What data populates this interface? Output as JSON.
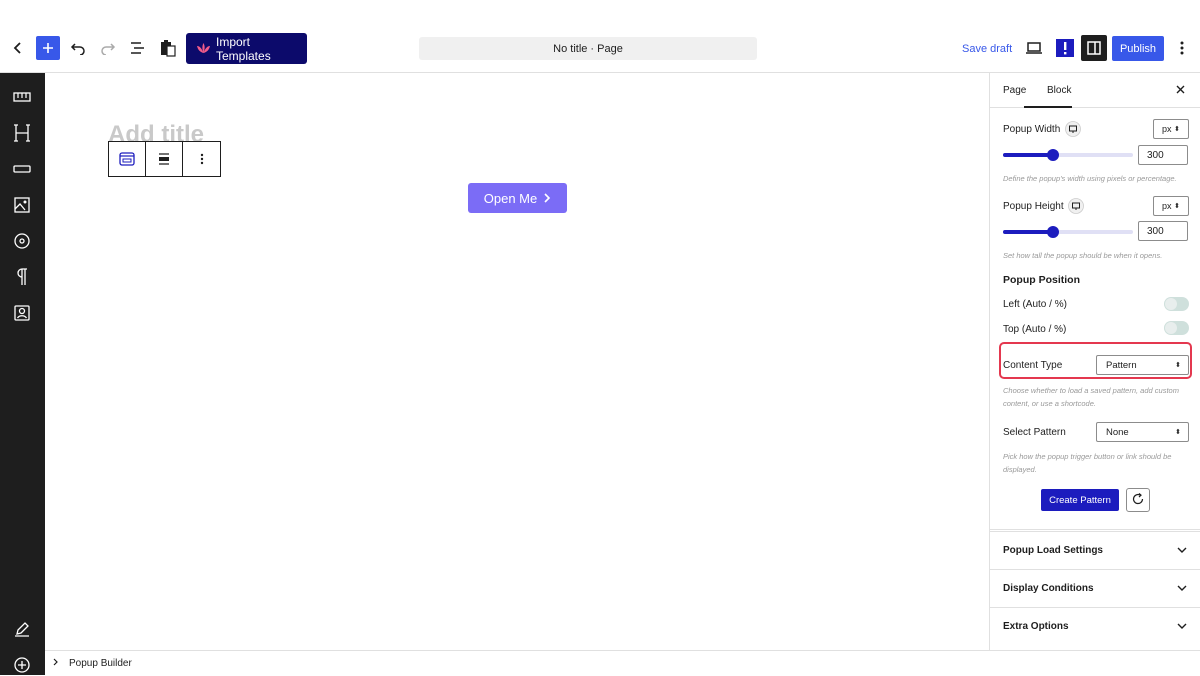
{
  "topbar": {
    "import_label": "Import Templates",
    "document_title": "No title · Page",
    "save_draft": "Save draft",
    "publish": "Publish",
    "colors": {
      "accent": "#3858e9",
      "import_bg": "#0c0a6b"
    }
  },
  "canvas": {
    "title_placeholder": "Add title",
    "button_label": "Open Me",
    "button_color": "#7b6cf6"
  },
  "footer": {
    "breadcrumb": "Popup Builder"
  },
  "sidebar": {
    "tabs": [
      "Page",
      "Block"
    ],
    "active_tab": "Block",
    "popup_width": {
      "label": "Popup Width",
      "unit": "px",
      "value": "300",
      "slider_fraction": 0.5,
      "help": "Define the popup's width using pixels or percentage."
    },
    "popup_height": {
      "label": "Popup Height",
      "unit": "px",
      "value": "300",
      "slider_fraction": 0.5,
      "help": "Set how tall the popup should be when it opens."
    },
    "position": {
      "title": "Popup Position",
      "left_label": "Left (Auto / %)",
      "top_label": "Top (Auto / %)"
    },
    "content_type": {
      "label": "Content Type",
      "value": "Pattern",
      "help": "Choose whether to load a saved pattern, add custom content, or use a shortcode."
    },
    "select_pattern": {
      "label": "Select Pattern",
      "value": "None",
      "help": "Pick how the popup trigger button or link should be displayed."
    },
    "create_pattern": "Create Pattern",
    "accordions": [
      "Popup Load Settings",
      "Display Conditions",
      "Extra Options"
    ],
    "highlight_color": "#e4384f"
  }
}
